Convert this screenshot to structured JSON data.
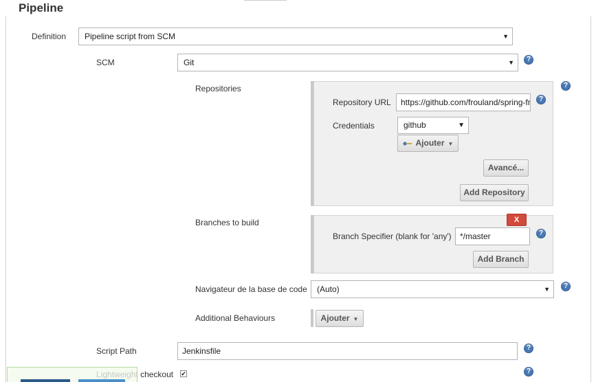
{
  "section": {
    "title": "Pipeline"
  },
  "definition": {
    "label": "Definition",
    "value": "Pipeline script from SCM"
  },
  "scm": {
    "label": "SCM",
    "value": "Git"
  },
  "repositories": {
    "label": "Repositories",
    "url_label": "Repository URL",
    "url_value": "https://github.com/frouland/spring-fr",
    "credentials_label": "Credentials",
    "credentials_value": "github",
    "add_credentials_label": "Ajouter",
    "advanced_label": "Avancé...",
    "add_repository_label": "Add Repository"
  },
  "branches": {
    "label": "Branches to build",
    "delete_label": "X",
    "specifier_label": "Branch Specifier (blank for 'any')",
    "specifier_value": "*/master",
    "add_branch_label": "Add Branch"
  },
  "browser": {
    "label": "Navigateur de la base de code",
    "value": "(Auto)"
  },
  "behaviours": {
    "label": "Additional Behaviours",
    "add_label": "Ajouter"
  },
  "script_path": {
    "label": "Script Path",
    "value": "Jenkinsfile"
  },
  "lightweight": {
    "label_faded": "Lightweight",
    "label": "checkout",
    "checked": "✔"
  },
  "icons": {
    "help": "?",
    "dropdown": "▼",
    "key": "key-icon"
  }
}
